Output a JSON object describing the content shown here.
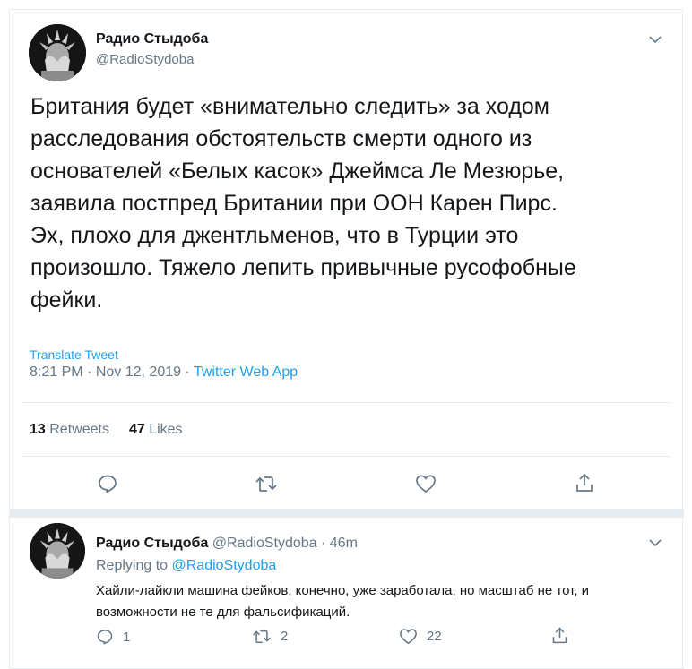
{
  "tweet": {
    "display_name": "Радио Стыдоба",
    "handle": "@RadioStydoba",
    "text": "Британия будет «внимательно следить» за ходом\nрасследования обстоятельств смерти одного из\nосновате­лей «Белых касок» Джеймса Ле Мезюрье,\nзаявила постпред Британии при ООН Карен Пирс.\nЭх, плохо для джентльменов, что в Турции это\nпроизошло. Тяжело лепить привычные русофобные\nфейки.",
    "translate_label": "Translate Tweet",
    "time": "8:21 PM",
    "date": "Nov 12, 2019",
    "separator": "·",
    "source_app": "Twitter Web App",
    "retweets_count": "13",
    "retweets_label": "Retweets",
    "likes_count": "47",
    "likes_label": "Likes"
  },
  "reply": {
    "display_name": "Радио Стыдоба",
    "handle": "@RadioStydoba",
    "separator": "·",
    "age": "46m",
    "replying_to_label": "Replying to",
    "replying_to_handle": "@RadioStydoba",
    "text": "Хайли-лайкли машина фейков, конечно, уже заработала, но масштаб не тот, и возможности не те для фальсификаций.",
    "reply_count": "1",
    "retweet_count": "2",
    "like_count": "22"
  },
  "icons": {
    "reply": "reply-icon",
    "retweet": "retweet-icon",
    "like": "heart-icon",
    "share": "share-icon",
    "more": "chevron-down-icon"
  },
  "colors": {
    "accent": "#1da1f2",
    "muted": "#657786",
    "text": "#14171a",
    "divider": "#e6ecf0"
  }
}
